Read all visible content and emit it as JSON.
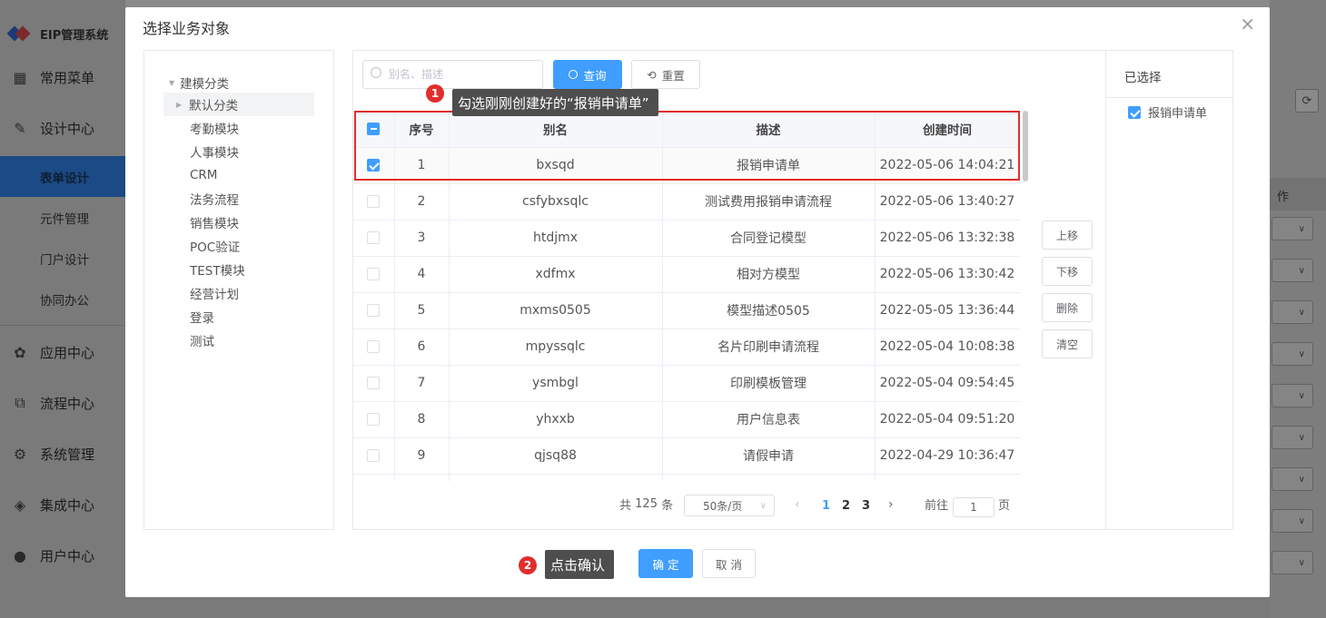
{
  "app": {
    "brand": "EIP管理系统",
    "nav": [
      {
        "label": "常用菜单",
        "icon": "grid-icon"
      },
      {
        "label": "设计中心",
        "icon": "design-icon"
      },
      {
        "label": "应用中心",
        "icon": "apps-icon"
      },
      {
        "label": "流程中心",
        "icon": "flow-icon"
      },
      {
        "label": "系统管理",
        "icon": "gear-icon"
      },
      {
        "label": "集成中心",
        "icon": "layers-icon"
      },
      {
        "label": "用户中心",
        "icon": "user-icon"
      }
    ],
    "subnav": [
      "表单设计",
      "元件管理",
      "门户设计",
      "协同办公"
    ],
    "bg_col_head": "作"
  },
  "modal": {
    "title": "选择业务对象",
    "close": "×"
  },
  "tree": {
    "root": "建模分类",
    "items": [
      "默认分类",
      "考勤模块",
      "人事模块",
      "CRM",
      "法务流程",
      "销售模块",
      "POC验证",
      "TEST模块",
      "经营计划",
      "登录",
      "测试"
    ]
  },
  "search": {
    "placeholder": "别名、描述",
    "query_label": "查询",
    "reset_label": "重置"
  },
  "table": {
    "columns": [
      "序号",
      "别名",
      "描述",
      "创建时间"
    ],
    "rows": [
      {
        "no": "1",
        "alias": "bxsqd",
        "desc": "报销申请单",
        "created": "2022-05-06 14:04:21",
        "checked": true
      },
      {
        "no": "2",
        "alias": "csfybxsqlc",
        "desc": "测试费用报销申请流程",
        "created": "2022-05-06 13:40:27",
        "checked": false
      },
      {
        "no": "3",
        "alias": "htdjmx",
        "desc": "合同登记模型",
        "created": "2022-05-06 13:32:38",
        "checked": false
      },
      {
        "no": "4",
        "alias": "xdfmx",
        "desc": "相对方模型",
        "created": "2022-05-06 13:30:42",
        "checked": false
      },
      {
        "no": "5",
        "alias": "mxms0505",
        "desc": "模型描述0505",
        "created": "2022-05-05 13:36:44",
        "checked": false
      },
      {
        "no": "6",
        "alias": "mpyssqlc",
        "desc": "名片印刷申请流程",
        "created": "2022-05-04 10:08:38",
        "checked": false
      },
      {
        "no": "7",
        "alias": "ysmbgl",
        "desc": "印刷模板管理",
        "created": "2022-05-04 09:54:45",
        "checked": false
      },
      {
        "no": "8",
        "alias": "yhxxb",
        "desc": "用户信息表",
        "created": "2022-05-04 09:51:20",
        "checked": false
      },
      {
        "no": "9",
        "alias": "qjsq88",
        "desc": "请假申请",
        "created": "2022-04-29 10:36:47",
        "checked": false
      }
    ]
  },
  "pagination": {
    "total_prefix": "共",
    "total": "125",
    "total_suffix": "条",
    "page_size": "50条/页",
    "pages": [
      "1",
      "2",
      "3"
    ],
    "current_page": "1",
    "goto_prefix": "前往",
    "goto_value": "1",
    "goto_suffix": "页"
  },
  "move_buttons": [
    "上移",
    "下移",
    "删除",
    "清空"
  ],
  "selected": {
    "title": "已选择",
    "items": [
      "报销申请单"
    ]
  },
  "footer": {
    "confirm": "确 定",
    "cancel": "取 消"
  },
  "annotations": {
    "step1_badge": "1",
    "step1_text": "勾选刚刚创建好的“报销申请单”",
    "step2_badge": "2",
    "step2_text": "点击确认"
  },
  "colors": {
    "primary": "#409eff",
    "annotation_red": "#e12d2d",
    "tooltip_bg": "#4e4e4e"
  }
}
